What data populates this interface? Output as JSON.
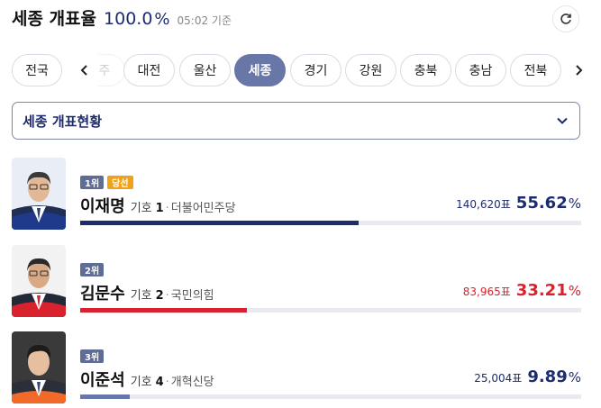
{
  "header": {
    "title": "세종 개표율",
    "percent": "100.0",
    "percent_unit": "%",
    "time": "05:02 기준"
  },
  "tabs": [
    {
      "label": "전국",
      "active": false
    },
    {
      "label": "주",
      "active": false,
      "faded": true
    },
    {
      "label": "대전",
      "active": false
    },
    {
      "label": "울산",
      "active": false
    },
    {
      "label": "세종",
      "active": true
    },
    {
      "label": "경기",
      "active": false
    },
    {
      "label": "강원",
      "active": false
    },
    {
      "label": "충북",
      "active": false
    },
    {
      "label": "충남",
      "active": false
    },
    {
      "label": "전북",
      "active": false
    }
  ],
  "dropdown": {
    "label": "세종 개표현황"
  },
  "candidates": [
    {
      "rank": "1위",
      "elected": "당선",
      "name": "이재명",
      "giho_label": "기호",
      "giho_num": "1",
      "party": "더불어민주당",
      "votes": "140,620",
      "votes_unit": "표",
      "share": "55.62",
      "share_unit": "%",
      "share_value": 55.62,
      "color": "#1d2c6e",
      "accent": "#1f3a8a"
    },
    {
      "rank": "2위",
      "name": "김문수",
      "giho_label": "기호",
      "giho_num": "2",
      "party": "국민의힘",
      "votes": "83,965",
      "votes_unit": "표",
      "share": "33.21",
      "share_unit": "%",
      "share_value": 33.21,
      "color": "#d8232f",
      "accent": "#d8232f"
    },
    {
      "rank": "3위",
      "name": "이준석",
      "giho_label": "기호",
      "giho_num": "4",
      "party": "개혁신당",
      "votes": "25,004",
      "votes_unit": "표",
      "share": "9.89",
      "share_unit": "%",
      "share_value": 9.89,
      "color": "#1d2c6e",
      "accent": "#f26a2a"
    }
  ],
  "colors": {
    "accent": "#6877a8",
    "navy": "#1d2c6e",
    "red": "#d8232f",
    "gold": "#f0a21a"
  }
}
